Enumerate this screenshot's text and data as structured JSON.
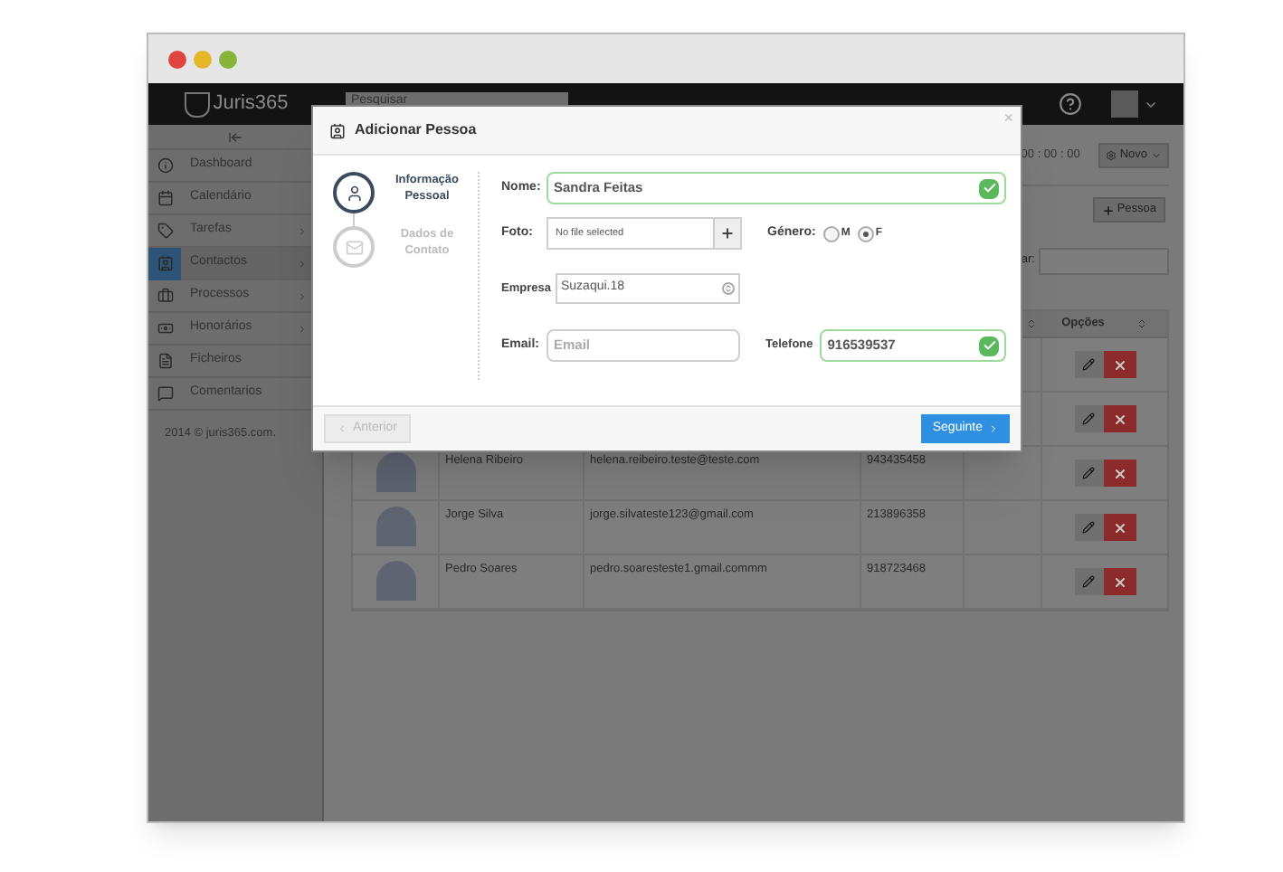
{
  "app": {
    "logo": "Juris365",
    "search": {
      "placeholder": "Pesquisar"
    }
  },
  "sidebar": {
    "items": [
      {
        "label": "Dashboard",
        "selected": false,
        "expandable": false
      },
      {
        "label": "Calendário",
        "selected": false,
        "expandable": false
      },
      {
        "label": "Tarefas",
        "selected": false,
        "expandable": true
      },
      {
        "label": "Contactos",
        "selected": true,
        "expandable": true
      },
      {
        "label": "Processos",
        "selected": false,
        "expandable": true
      },
      {
        "label": "Honorários",
        "selected": false,
        "expandable": true
      },
      {
        "label": "Ficheiros",
        "selected": false,
        "expandable": false
      },
      {
        "label": "Comentarios",
        "selected": false,
        "expandable": false
      }
    ],
    "footer": "2014 © juris365.com."
  },
  "toolbar": {
    "timer": "00 : 00 : 00",
    "new_button": "Novo",
    "add_button": "Pessoa",
    "filter_label": "ar:"
  },
  "table": {
    "columns": [
      {
        "label": "Opções"
      }
    ],
    "rows": [
      {},
      {},
      {
        "name": "Helena Ribeiro",
        "email": "helena.reibeiro.teste@teste.com",
        "phone": "943435458"
      },
      {
        "name": "Jorge Silva",
        "email": "jorge.silvateste123@gmail.com",
        "phone": "213896358"
      },
      {
        "name": "Pedro Soares",
        "email": "pedro.soaresteste1.gmail.commm",
        "phone": "918723468"
      }
    ]
  },
  "modal": {
    "title": "Adicionar Pessoa",
    "close": "×",
    "steps": [
      {
        "label": "Informação Pessoal",
        "selected": true
      },
      {
        "label": "Dados de Contato",
        "selected": false
      }
    ],
    "name": {
      "label": "Nome:",
      "value": "Sandra Feitas",
      "valid": true
    },
    "photo": {
      "label": "Foto:",
      "value": "No file selected"
    },
    "gender": {
      "label": "Género:",
      "options": [
        {
          "label": "M",
          "selected": false
        },
        {
          "label": "F",
          "selected": true
        }
      ]
    },
    "company": {
      "label": "Empresa",
      "value": "Suzaqui.18"
    },
    "email": {
      "label": "Email:",
      "placeholder": "Email"
    },
    "phone": {
      "label": "Telefone",
      "value": "916539537",
      "valid": true
    },
    "back_button": {
      "label": "Anterior",
      "disabled": true
    },
    "next_button": {
      "label": "Seguinte",
      "disabled": false
    }
  }
}
